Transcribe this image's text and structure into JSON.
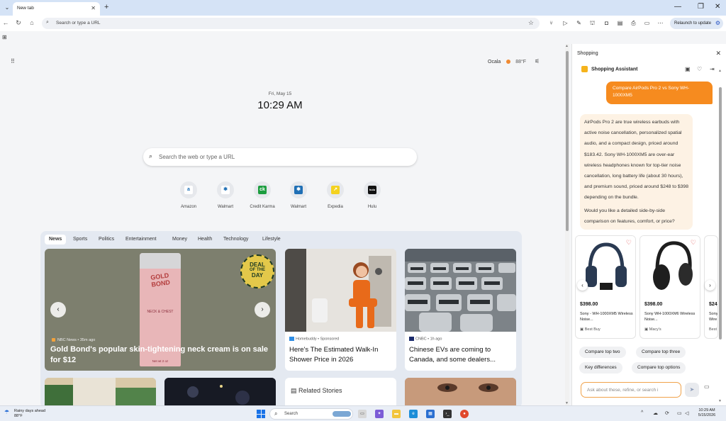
{
  "browser": {
    "tab_title": "New tab",
    "address_placeholder": "Search or type a URL",
    "refresh_label": "Relaunch to update"
  },
  "ntp": {
    "weather": {
      "city": "Ocala",
      "temp": "88°F"
    },
    "date": "Fri, May 15",
    "time": "10:29 AM",
    "search_placeholder": "Search the web or type a URL",
    "tiles": [
      {
        "label": "Amazon",
        "glyph": "a",
        "color": "#ffffff"
      },
      {
        "label": "Walmart",
        "glyph": "✱",
        "color": "#ffffff"
      },
      {
        "label": "Credit Karma",
        "glyph": "ck",
        "color": "#1c9d3f"
      },
      {
        "label": "Walmart",
        "glyph": "✱",
        "color": "#1f6fb5"
      },
      {
        "label": "Expedia",
        "glyph": "↗",
        "color": "#f4d21f"
      },
      {
        "label": "Hulu",
        "glyph": "hulu",
        "color": "#111111"
      }
    ],
    "feed_tabs": [
      "News",
      "Sports",
      "Politics",
      "Entertainment",
      "Money",
      "Health",
      "Technology",
      "Lifestyle"
    ],
    "hero": {
      "source": "NBC News • 35m ago",
      "headline": "Gold Bond's popular skin-tightening neck cream is on sale for $12",
      "product_brand": "GOLD BOND",
      "product_sub": "NECK & CHEST",
      "product_net": "Net wt 2 oz",
      "badge": [
        "DEAL",
        "OF THE",
        "DAY"
      ]
    },
    "cards": [
      {
        "source": "Homebuddy • Sponsored",
        "title": "Here's The Estimated Walk-In Shower Price in 2026"
      },
      {
        "source": "CNBC • 1h ago",
        "title": "Chinese EVs are coming to Canada, and some dealers..."
      }
    ],
    "related_label": "Related Stories"
  },
  "panel": {
    "title": "Shopping",
    "assistant_title": "Shopping Assistant",
    "user_message": "Compare AirPods Pro 2 vs Sony WH-1000XM5",
    "bot_paragraph_1": "AirPods Pro 2 are true wireless earbuds with active noise cancellation, personalized spatial audio, and a compact design, priced around $183.42. Sony WH-1000XM5 are over-ear wireless headphones known for top-tier noise cancellation, long battery life (about 30 hours), and premium sound, priced around $248 to $398 depending on the bundle.",
    "bot_paragraph_2": "Would you like a detailed side-by-side comparison on features, comfort, or price?",
    "products": [
      {
        "price": "$398.00",
        "name": "Sony - WH-1000XM5 Wireless Noise...",
        "seller": "Best Buy"
      },
      {
        "price": "$398.00",
        "name": "Sony WH-1000XM6 Wireless Noise...",
        "seller": "Macy's"
      },
      {
        "price": "$24",
        "name": "Sony Wire",
        "seller": "Best"
      }
    ],
    "chips": [
      "Compare top two",
      "Compare top three",
      "Key differences",
      "Compare top options"
    ],
    "ask_placeholder": "Ask about these, refine, or search i"
  },
  "taskbar": {
    "weather_line1": "Rainy days ahead",
    "weather_line2": "88°F",
    "search_placeholder": "Search",
    "time": "10:29 AM",
    "date": "5/15/2026"
  }
}
